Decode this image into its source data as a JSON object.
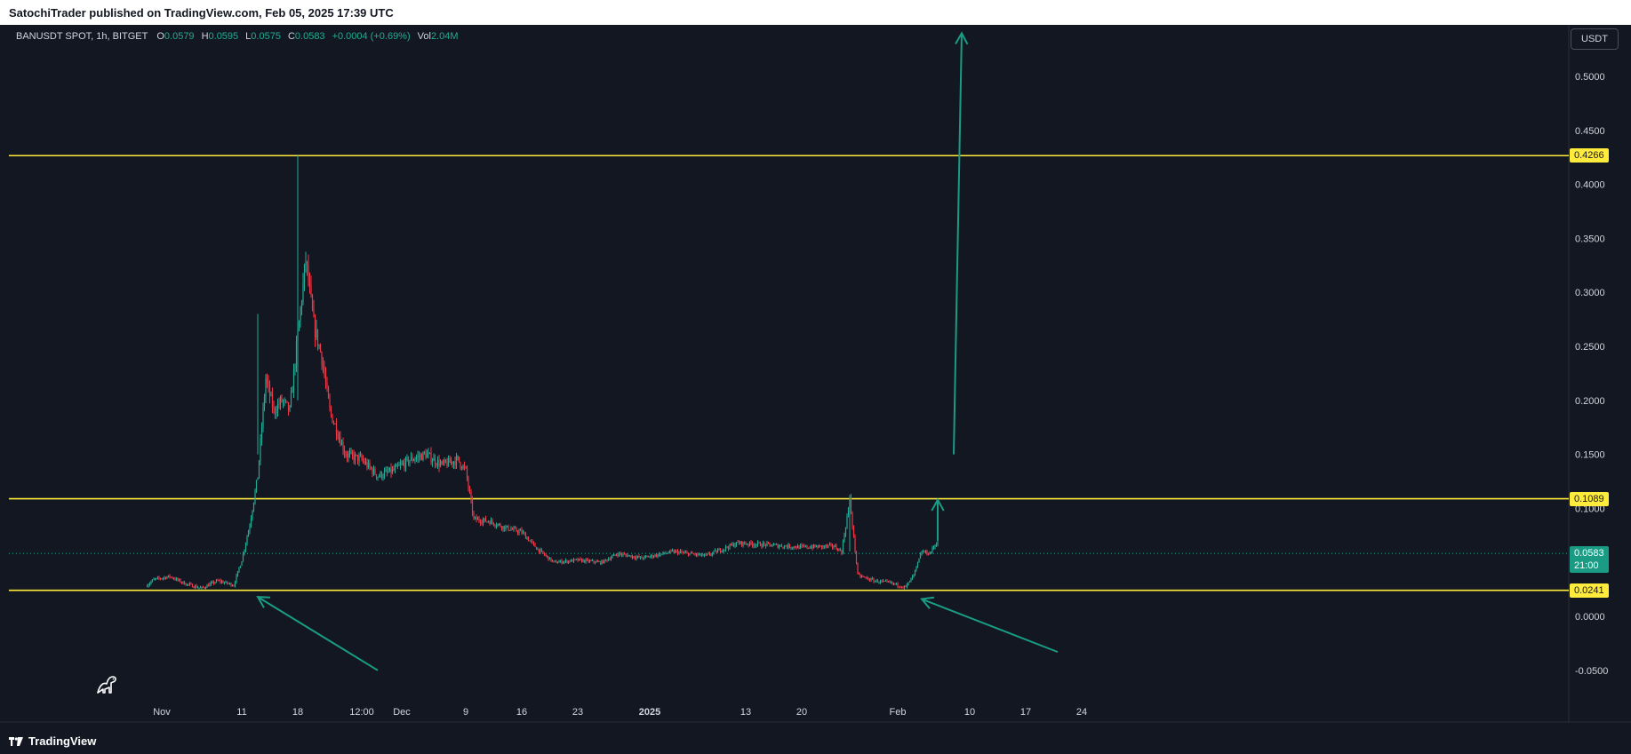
{
  "header": {
    "published_text": "SatochiTrader published on TradingView.com, Feb 05, 2025 17:39 UTC"
  },
  "legend": {
    "symbol": "BANUSDT SPOT, 1h, BITGET",
    "open_label": "O",
    "open": "0.0579",
    "high_label": "H",
    "high": "0.0595",
    "low_label": "L",
    "low": "0.0575",
    "close_label": "C",
    "close": "0.0583",
    "change": "+0.0004 (+0.69%)",
    "vol_label": "Vol",
    "vol": "2.04M"
  },
  "currency_button": {
    "label": "USDT"
  },
  "footer": {
    "brand": "TradingView"
  },
  "current_price": {
    "price": "0.0583",
    "countdown": "21:00"
  },
  "icons": {
    "logo": "tradingview-logo-icon",
    "corner": "dinosaur-icon"
  },
  "colors": {
    "background": "#131722",
    "up": "#22ab94",
    "down": "#f23645",
    "level_line": "#ffeb3b",
    "arrow": "#1a9c84",
    "axis_text": "#d1d4dc"
  },
  "chart_data": {
    "type": "candlestick",
    "ylim": [
      -0.07,
      0.55
    ],
    "y_ticks": [
      "0.5000",
      "0.4500",
      "0.4000",
      "0.3500",
      "0.3000",
      "0.2500",
      "0.2000",
      "0.1500",
      "0.1000",
      "0.0000",
      "-0.0500"
    ],
    "x_ticks": [
      "Nov",
      "11",
      "18",
      "12:00",
      "Dec",
      "9",
      "16",
      "23",
      "2025",
      "13",
      "20",
      "Feb",
      "10",
      "17",
      "24"
    ],
    "levels": [
      {
        "label": "0.4266",
        "value": 0.4266
      },
      {
        "label": "0.1089",
        "value": 0.1089
      },
      {
        "label": "0.0241",
        "value": 0.0241
      }
    ],
    "price_path": [
      [
        "2024-10-30",
        0.028
      ],
      [
        "2024-10-31",
        0.034
      ],
      [
        "2024-11-02",
        0.037
      ],
      [
        "2024-11-04",
        0.03
      ],
      [
        "2024-11-06",
        0.026
      ],
      [
        "2024-11-08",
        0.033
      ],
      [
        "2024-11-10",
        0.029
      ],
      [
        "2024-11-11",
        0.052
      ],
      [
        "2024-11-12",
        0.085
      ],
      [
        "2024-11-13",
        0.13
      ],
      [
        "2024-11-14",
        0.22
      ],
      [
        "2024-11-15",
        0.19
      ],
      [
        "2024-11-16",
        0.2
      ],
      [
        "2024-11-17",
        0.19
      ],
      [
        "2024-11-18",
        0.26
      ],
      [
        "2024-11-19",
        0.33
      ],
      [
        "2024-11-20",
        0.27
      ],
      [
        "2024-11-21",
        0.24
      ],
      [
        "2024-11-22",
        0.19
      ],
      [
        "2024-11-24",
        0.15
      ],
      [
        "2024-11-26",
        0.145
      ],
      [
        "2024-11-28",
        0.13
      ],
      [
        "2024-11-30",
        0.135
      ],
      [
        "2024-12-02",
        0.145
      ],
      [
        "2024-12-04",
        0.15
      ],
      [
        "2024-12-06",
        0.14
      ],
      [
        "2024-12-08",
        0.145
      ],
      [
        "2024-12-09",
        0.135
      ],
      [
        "2024-12-10",
        0.09
      ],
      [
        "2024-12-12",
        0.088
      ],
      [
        "2024-12-14",
        0.082
      ],
      [
        "2024-12-16",
        0.078
      ],
      [
        "2024-12-18",
        0.062
      ],
      [
        "2024-12-20",
        0.05
      ],
      [
        "2024-12-23",
        0.052
      ],
      [
        "2024-12-26",
        0.05
      ],
      [
        "2024-12-28",
        0.058
      ],
      [
        "2024-12-31",
        0.054
      ],
      [
        "2025-01-04",
        0.06
      ],
      [
        "2025-01-08",
        0.056
      ],
      [
        "2025-01-12",
        0.068
      ],
      [
        "2025-01-16",
        0.066
      ],
      [
        "2025-01-20",
        0.064
      ],
      [
        "2025-01-24",
        0.065
      ],
      [
        "2025-01-25",
        0.06
      ],
      [
        "2025-01-26",
        0.108
      ],
      [
        "2025-01-27",
        0.038
      ],
      [
        "2025-01-29",
        0.033
      ],
      [
        "2025-01-31",
        0.031
      ],
      [
        "2025-02-02",
        0.027
      ],
      [
        "2025-02-03",
        0.038
      ],
      [
        "2025-02-04",
        0.06
      ],
      [
        "2025-02-05",
        0.0583
      ],
      [
        "2025-02-06",
        0.07
      ]
    ],
    "annotations": [
      {
        "type": "arrow-up",
        "from": [
          "2025-02-08",
          0.15
        ],
        "to": [
          "2025-02-09",
          0.54
        ]
      },
      {
        "type": "arrow-up",
        "from": [
          "2025-02-06",
          0.07
        ],
        "to": [
          "2025-02-06",
          0.108
        ]
      },
      {
        "type": "arrow-pointer",
        "from": [
          "2024-11-28",
          -0.05
        ],
        "to": [
          "2024-11-13",
          0.018
        ]
      },
      {
        "type": "arrow-pointer",
        "from": [
          "2025-02-21",
          -0.033
        ],
        "to": [
          "2025-02-04",
          0.016
        ]
      }
    ]
  }
}
